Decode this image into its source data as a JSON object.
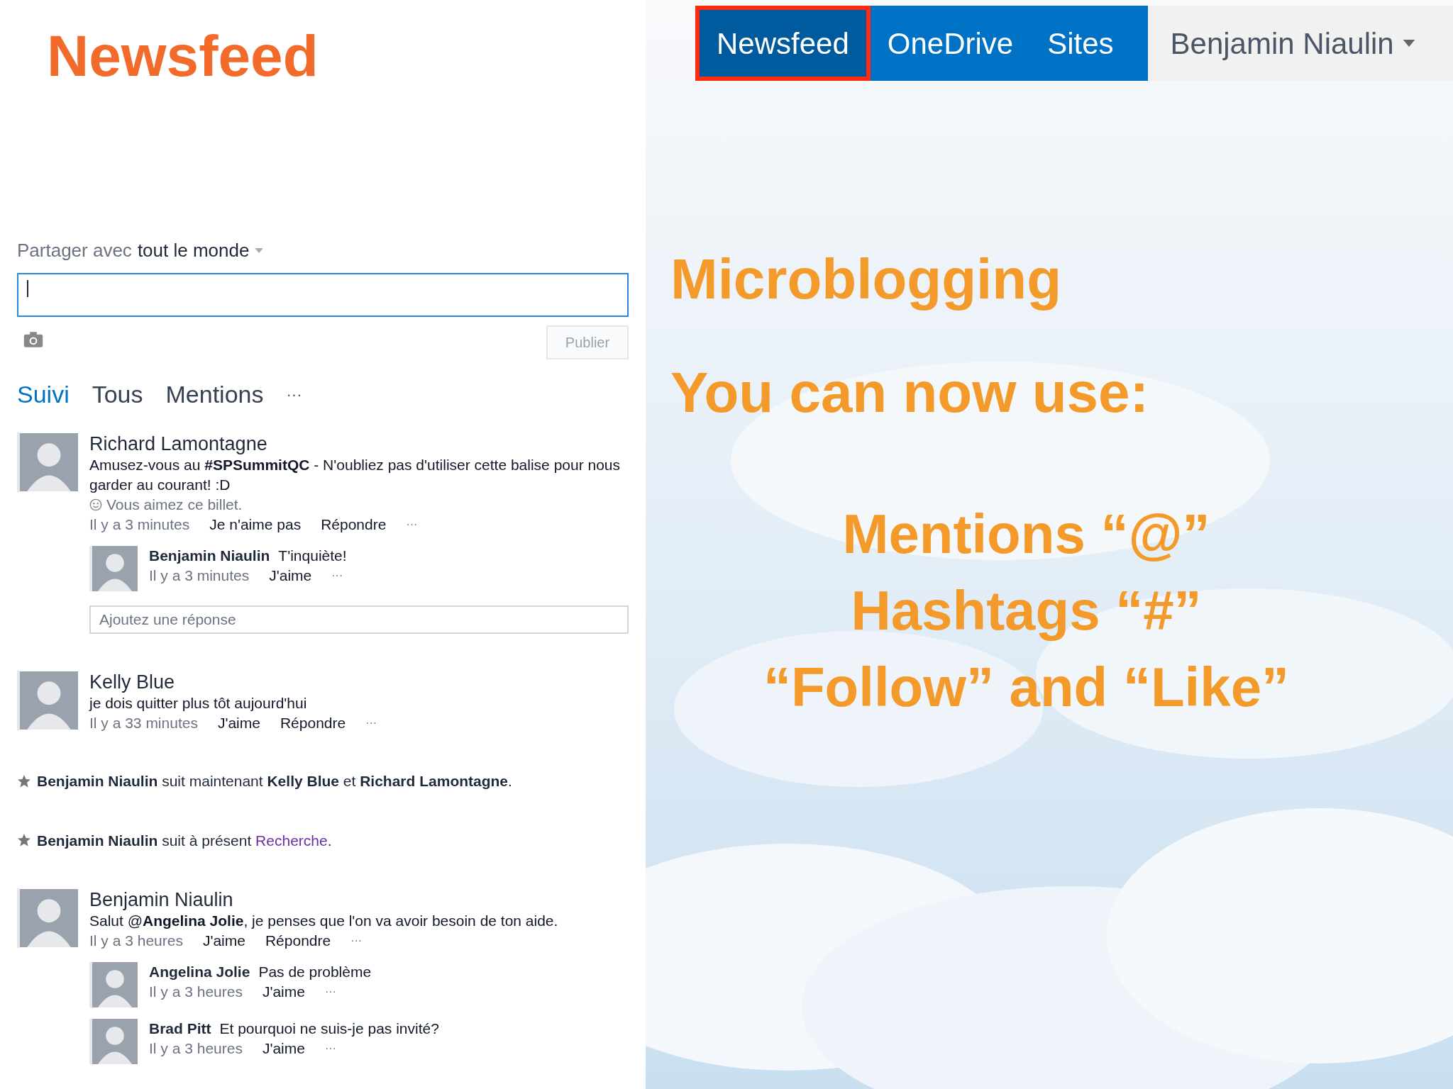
{
  "slide_title": "Newsfeed",
  "nav": {
    "tabs": [
      {
        "label": "Newsfeed",
        "selected": true,
        "highlighted": true
      },
      {
        "label": "OneDrive",
        "selected": false,
        "highlighted": false
      },
      {
        "label": "Sites",
        "selected": false,
        "highlighted": false
      }
    ],
    "user": "Benjamin Niaulin"
  },
  "composer": {
    "share_prefix": "Partager avec",
    "share_target": "tout le monde",
    "publish": "Publier"
  },
  "feed_tabs": [
    {
      "label": "Suivi",
      "selected": true
    },
    {
      "label": "Tous",
      "selected": false
    },
    {
      "label": "Mentions",
      "selected": false
    }
  ],
  "feed_tabs_more": "···",
  "feed": [
    {
      "kind": "post",
      "author": "Richard Lamontagne",
      "text": "Amusez-vous au **#SPSummitQC** - N'oubliez pas d'utiliser cette balise pour nous garder au courant! :D",
      "liked_note": "Vous aimez ce billet.",
      "time": "Il y a 3 minutes",
      "actions": [
        "Je n'aime pas",
        "Répondre"
      ],
      "more": "···",
      "replies": [
        {
          "author": "Benjamin Niaulin",
          "text": "T'inquiète!",
          "time": "Il y a 3 minutes",
          "actions": [
            "J'aime"
          ],
          "more": "···"
        }
      ],
      "reply_placeholder": "Ajoutez une réponse"
    },
    {
      "kind": "post",
      "author": "Kelly Blue",
      "text": "je dois quitter plus tôt aujourd'hui",
      "time": "Il y a 33 minutes",
      "actions": [
        "J'aime",
        "Répondre"
      ],
      "more": "···"
    },
    {
      "kind": "activity",
      "text": "**Benjamin Niaulin** suit maintenant **Kelly Blue** et **Richard Lamontagne**."
    },
    {
      "kind": "activity",
      "text": "**Benjamin Niaulin** suit à présent ",
      "link": "Recherche",
      "after": "."
    },
    {
      "kind": "post",
      "author": "Benjamin Niaulin",
      "text": "Salut @**Angelina Jolie**, je penses que l'on va avoir besoin de ton aide.",
      "time": "Il y a 3 heures",
      "actions": [
        "J'aime",
        "Répondre"
      ],
      "more": "···",
      "replies": [
        {
          "author": "Angelina Jolie",
          "text": "Pas de problème",
          "time": "Il y a 3 heures",
          "actions": [
            "J'aime"
          ],
          "more": "···"
        },
        {
          "author": "Brad Pitt",
          "text": "Et pourquoi ne suis-je pas invité?",
          "time": "Il y a 3 heures",
          "actions": [
            "J'aime"
          ],
          "more": "···"
        }
      ]
    }
  ],
  "slide": {
    "heading": "Microblogging",
    "subheading": "You can now use:",
    "points": [
      "Mentions “@”",
      "Hashtags “#”",
      "“Follow” and “Like”"
    ]
  }
}
